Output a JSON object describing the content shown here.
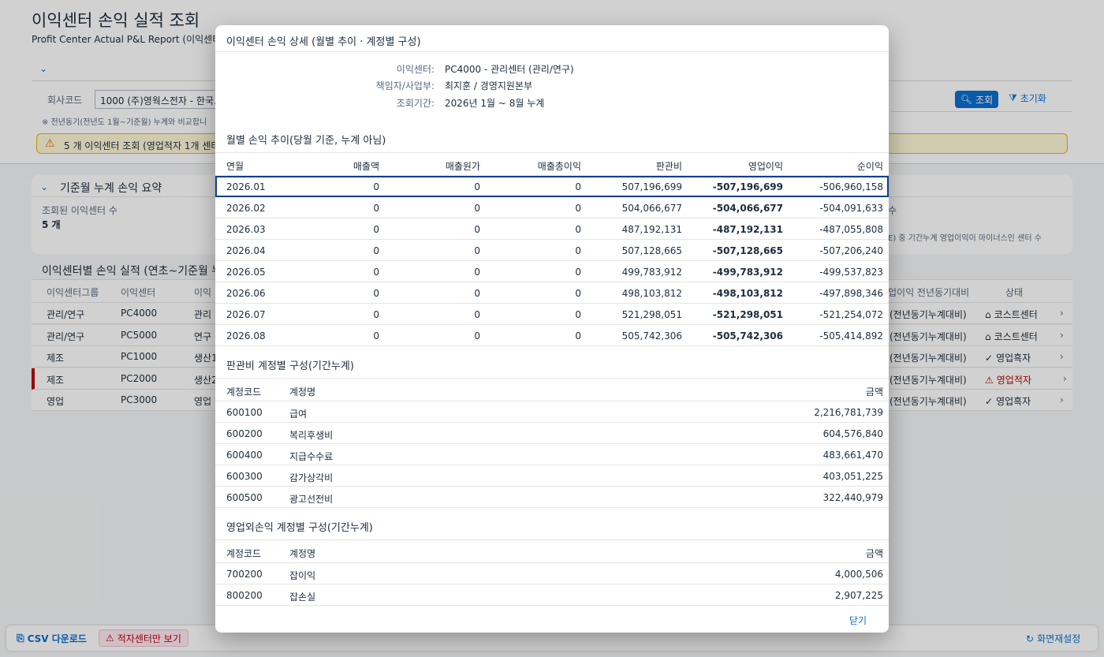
{
  "background": {
    "title": "이익센터 손익 실적 조회",
    "subtitle": "Profit Center Actual P&L Report (이익센터별",
    "filter": {
      "label": "회사코드",
      "value": "1000 (주)영웍스전자 - 한국..."
    },
    "search_label": "조회",
    "reset_label": "초기화",
    "note": "※ 전년동기(전년도 1월~기준월) 누계와 비교합니",
    "warning": "5 개 이익센터 조회 (영업적자 1개 센터",
    "summary": {
      "title": "기준월 누계 손익 요약",
      "kpi_label": "조회된 이익센터 수",
      "kpi_value": "5 개",
      "right_label": "수",
      "right_desc": "E) 중 기간누계 영업이익이 마이너스인 센터 수"
    },
    "table_title": "이익센터별 손익 실적 (연초~기준월 누",
    "columns": [
      "이익센터그룹",
      "이익센터",
      "이익",
      "업이익 전년동기대비",
      "상태"
    ],
    "rows": [
      {
        "group": "관리/연구",
        "center": "PC4000",
        "name": "관리",
        "yoy": "(전년동기누계대비)",
        "status": "코스트센터",
        "kind": "cost"
      },
      {
        "group": "관리/연구",
        "center": "PC5000",
        "name": "연구",
        "yoy": "(전년동기누계대비)",
        "status": "코스트센터",
        "kind": "cost"
      },
      {
        "group": "제조",
        "center": "PC1000",
        "name": "생산1",
        "yoy": "(전년동기누계대비)",
        "status": "영업흑자",
        "kind": "ok"
      },
      {
        "group": "제조",
        "center": "PC2000",
        "name": "생산2",
        "yoy": "(전년동기누계대비)",
        "status": "영업적자",
        "kind": "bad"
      },
      {
        "group": "영업",
        "center": "PC3000",
        "name": "영업",
        "yoy": "(전년동기누계대비)",
        "status": "영업흑자",
        "kind": "ok"
      }
    ],
    "footer": {
      "csv_label": "CSV 다운로드",
      "deficit_label": "적자센터만 보기",
      "reset_screen_label": "화면재설정"
    }
  },
  "dialog": {
    "title": "이익센터 손익 상세 (월별 추이 · 계정별 구성)",
    "info": [
      {
        "label": "이익센터:",
        "value": "PC4000 - 관리센터 (관리/연구)"
      },
      {
        "label": "책임자/사업부:",
        "value": "최지훈 / 경영지원본부"
      },
      {
        "label": "조회기간:",
        "value": "2026년 1월 ~ 8월 누계"
      }
    ],
    "monthly": {
      "title": "월별 손익 추이(당월 기준, 누계 아님)",
      "columns": [
        "연월",
        "매출액",
        "매출원가",
        "매출총이익",
        "판관비",
        "영업이익",
        "순이익"
      ],
      "rows": [
        [
          "2026.01",
          "0",
          "0",
          "0",
          "507,196,699",
          "-507,196,699",
          "-506,960,158"
        ],
        [
          "2026.02",
          "0",
          "0",
          "0",
          "504,066,677",
          "-504,066,677",
          "-504,091,633"
        ],
        [
          "2026.03",
          "0",
          "0",
          "0",
          "487,192,131",
          "-487,192,131",
          "-487,055,808"
        ],
        [
          "2026.04",
          "0",
          "0",
          "0",
          "507,128,665",
          "-507,128,665",
          "-507,206,240"
        ],
        [
          "2026.05",
          "0",
          "0",
          "0",
          "499,783,912",
          "-499,783,912",
          "-499,537,823"
        ],
        [
          "2026.06",
          "0",
          "0",
          "0",
          "498,103,812",
          "-498,103,812",
          "-497,898,346"
        ],
        [
          "2026.07",
          "0",
          "0",
          "0",
          "521,298,051",
          "-521,298,051",
          "-521,254,072"
        ],
        [
          "2026.08",
          "0",
          "0",
          "0",
          "505,742,306",
          "-505,742,306",
          "-505,414,892"
        ]
      ]
    },
    "sga": {
      "title": "판관비 계정별 구성(기간누계)",
      "columns": [
        "계정코드",
        "계정명",
        "금액"
      ],
      "rows": [
        [
          "600100",
          "급여",
          "2,216,781,739"
        ],
        [
          "600200",
          "복리후생비",
          "604,576,840"
        ],
        [
          "600400",
          "지급수수료",
          "483,661,470"
        ],
        [
          "600300",
          "감가상각비",
          "403,051,225"
        ],
        [
          "600500",
          "광고선전비",
          "322,440,979"
        ]
      ]
    },
    "nonop": {
      "title": "영업외손익 계정별 구성(기간누계)",
      "columns": [
        "계정코드",
        "계정명",
        "금액"
      ],
      "rows": [
        [
          "700200",
          "잡이익",
          "4,000,506"
        ],
        [
          "800200",
          "잡손실",
          "2,907,225"
        ]
      ]
    },
    "close_label": "닫기"
  }
}
